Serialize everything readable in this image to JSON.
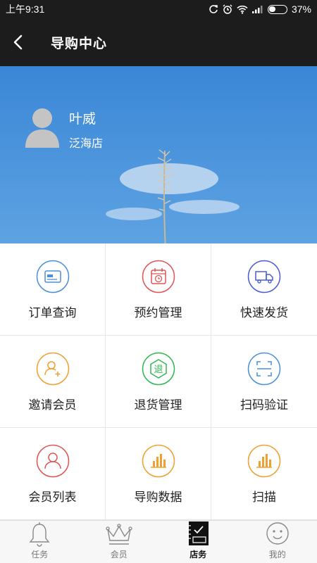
{
  "status_bar": {
    "time": "上午9:31",
    "battery": "37%",
    "battery_level": 0.37
  },
  "header": {
    "title": "导购中心"
  },
  "profile": {
    "name": "叶威",
    "store": "泛海店"
  },
  "grid": [
    {
      "label": "订单查询",
      "icon": "card-icon",
      "color": "#4a90d9"
    },
    {
      "label": "预约管理",
      "icon": "calendar-icon",
      "color": "#e05555"
    },
    {
      "label": "快速发货",
      "icon": "truck-icon",
      "color": "#4a5bd9"
    },
    {
      "label": "邀请会员",
      "icon": "add-user-icon",
      "color": "#f0a030"
    },
    {
      "label": "退货管理",
      "icon": "return-icon",
      "color": "#2eb84f"
    },
    {
      "label": "扫码验证",
      "icon": "scan-icon",
      "color": "#4a90d9"
    },
    {
      "label": "会员列表",
      "icon": "member-list-icon",
      "color": "#e05555"
    },
    {
      "label": "导购数据",
      "icon": "data-chart-icon",
      "color": "#f0a030"
    },
    {
      "label": "扫描",
      "icon": "scan-chart-icon",
      "color": "#f0a030"
    }
  ],
  "return_glyph": "退",
  "tabs": [
    {
      "label": "任务",
      "icon": "bell-icon",
      "active": false
    },
    {
      "label": "会员",
      "icon": "crown-icon",
      "active": false
    },
    {
      "label": "店务",
      "icon": "notebook-icon",
      "active": true
    },
    {
      "label": "我的",
      "icon": "smiley-icon",
      "active": false
    }
  ]
}
